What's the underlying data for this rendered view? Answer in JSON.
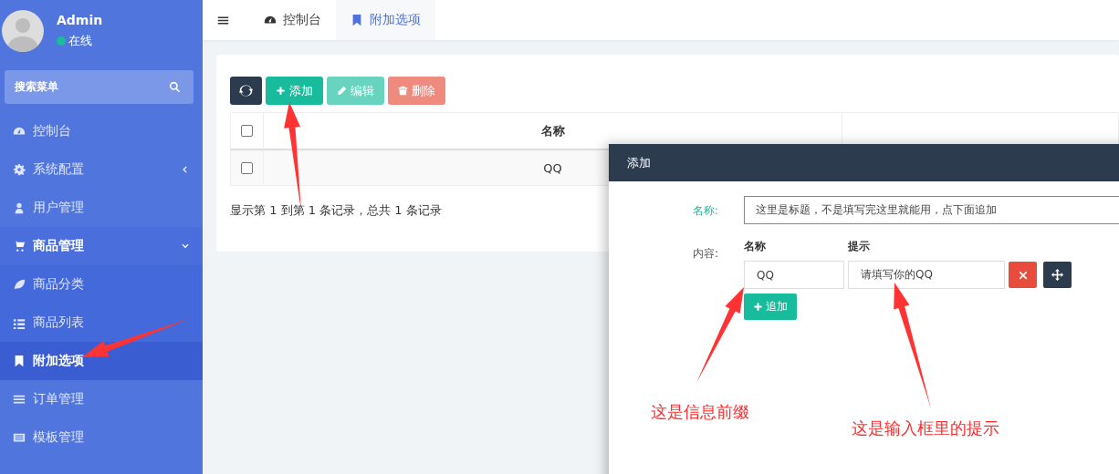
{
  "user": {
    "name": "Admin",
    "status": "在线",
    "online": true
  },
  "search": {
    "placeholder": "搜索菜单"
  },
  "sidebar": {
    "items": [
      {
        "label": "控制台",
        "kind": "link",
        "selected": false
      },
      {
        "label": "系统配置",
        "kind": "group",
        "expanded": false,
        "selected": false
      },
      {
        "label": "用户管理",
        "kind": "link",
        "selected": false
      },
      {
        "label": "商品管理",
        "kind": "group",
        "expanded": true,
        "selected": false,
        "children": [
          {
            "label": "商品分类",
            "selected": false
          },
          {
            "label": "商品列表",
            "selected": false
          },
          {
            "label": "附加选项",
            "selected": true
          }
        ]
      },
      {
        "label": "订单管理",
        "kind": "link",
        "selected": false
      },
      {
        "label": "模板管理",
        "kind": "link",
        "selected": false
      }
    ]
  },
  "tabs": [
    {
      "label": "控制台",
      "selected": false
    },
    {
      "label": "附加选项",
      "selected": true
    }
  ],
  "toolbar": [
    {
      "kind": "refresh",
      "disabled": false
    },
    {
      "kind": "add",
      "label": "添加",
      "disabled": false
    },
    {
      "kind": "edit",
      "label": "编辑",
      "disabled": true
    },
    {
      "kind": "delete",
      "label": "删除",
      "disabled": true
    }
  ],
  "table": {
    "header_checked": false,
    "columns": [
      "名称"
    ],
    "rows": [
      {
        "checked": false,
        "cells": [
          "QQ"
        ]
      }
    ]
  },
  "pagination": "显示第 1 到第 1 条记录，总共 1 条记录",
  "dialog": {
    "title": "添加",
    "name_label": "名称:",
    "name_value": "这里是标题，不是填写完这里就能用，点下面追加",
    "name_focused": true,
    "content_label": "内容:",
    "headers": [
      "名称",
      "提示"
    ],
    "rows": [
      {
        "name": "QQ",
        "hint": "请填写你的QQ"
      }
    ],
    "append_label": "追加"
  },
  "annotations": [
    "这是信息前缀",
    "这是输入框里的提示"
  ]
}
